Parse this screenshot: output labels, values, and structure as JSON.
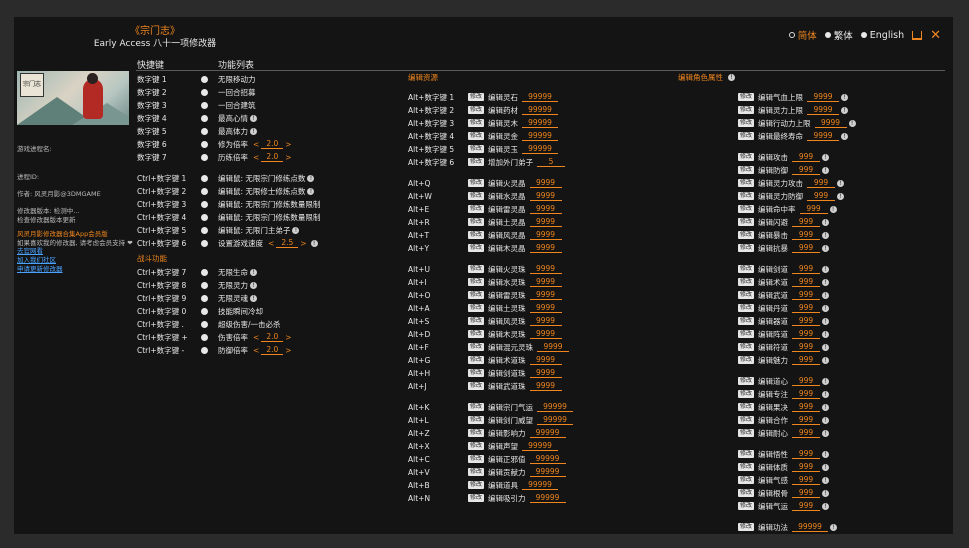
{
  "header": {
    "game_title": "《宗门志》",
    "app_title": "Early Access 八十一项修改器"
  },
  "languages": [
    {
      "label": "简体",
      "active": true
    },
    {
      "label": "繁体",
      "active": false
    },
    {
      "label": "English",
      "active": false
    }
  ],
  "columns": {
    "hotkey": "快捷键",
    "features": "功能列表"
  },
  "left_panel": {
    "process_label": "游戏进程名:",
    "pid_label": "进程ID:",
    "author": "作者: 风灵月影@3DMGAME",
    "version_line1": "修改器版本: 检测中...",
    "version_line2": "检查修改器版本更新",
    "promo": "风灵月影修改器合集App会员版",
    "promo_sub": "如果喜欢我的修改器, 请考虑会员支持 ❤",
    "link1": "去官网看",
    "link2": "加入我们社区",
    "link3": "申请更新修改器"
  },
  "col1": [
    {
      "hotkey": "数字键 1",
      "label": "无限移动力"
    },
    {
      "hotkey": "数字键 2",
      "label": "一回合招募"
    },
    {
      "hotkey": "数字键 3",
      "label": "一回合建筑"
    },
    {
      "hotkey": "数字键 4",
      "label": "最高心情",
      "tip": true
    },
    {
      "hotkey": "数字键 5",
      "label": "最高体力",
      "tip": true
    },
    {
      "hotkey": "数字键 6",
      "label": "修为倍率",
      "spin": "2.0"
    },
    {
      "hotkey": "数字键 7",
      "label": "历练倍率",
      "spin": "2.0"
    },
    {
      "gap": true
    },
    {
      "hotkey": "Ctrl+数字键 1",
      "label": "编辑鼠: 无限宗门修练点数",
      "tip": true
    },
    {
      "hotkey": "Ctrl+数字键 2",
      "label": "编辑鼠: 无限修士修炼点数",
      "tip": true
    },
    {
      "hotkey": "Ctrl+数字键 3",
      "label": "编辑鼠: 无限宗门修炼数量限制"
    },
    {
      "hotkey": "Ctrl+数字键 4",
      "label": "编辑鼠: 无限宗门修炼数量限制"
    },
    {
      "hotkey": "Ctrl+数字键 5",
      "label": "编辑鼠: 无限门主弟子",
      "tip": true
    },
    {
      "hotkey": "Ctrl+数字键 6",
      "label": "设置游戏速度",
      "spin": "2.5",
      "tip": true
    },
    {
      "section": "战斗功能"
    },
    {
      "hotkey": "Ctrl+数字键 7",
      "label": "无限生命",
      "tip": true
    },
    {
      "hotkey": "Ctrl+数字键 8",
      "label": "无限灵力",
      "tip": true
    },
    {
      "hotkey": "Ctrl+数字键 9",
      "label": "无限灵魂",
      "tip": true
    },
    {
      "hotkey": "Ctrl+数字键 0",
      "label": "技能瞬间冷却"
    },
    {
      "hotkey": "Ctrl+数字键 .",
      "label": "超级伤害/一击必杀"
    },
    {
      "hotkey": "Ctrl+数字键 +",
      "label": "伤害倍率",
      "spin": "2.0"
    },
    {
      "hotkey": "Ctrl+数字键 -",
      "label": "防御倍率",
      "spin": "2.0"
    }
  ],
  "col2_title": "编辑资源",
  "col2": [
    {
      "hotkey": "Alt+数字键 1",
      "label": "编辑灵石",
      "value": "99999"
    },
    {
      "hotkey": "Alt+数字键 2",
      "label": "编辑药材",
      "value": "99999"
    },
    {
      "hotkey": "Alt+数字键 3",
      "label": "编辑灵木",
      "value": "99999"
    },
    {
      "hotkey": "Alt+数字键 4",
      "label": "编辑灵金",
      "value": "99999"
    },
    {
      "hotkey": "Alt+数字键 5",
      "label": "编辑灵玉",
      "value": "99999"
    },
    {
      "hotkey": "Alt+数字键 6",
      "label": "增加外门弟子",
      "value": "5"
    },
    {
      "gap": true
    },
    {
      "hotkey": "Alt+Q",
      "label": "编辑火灵晶",
      "value": "9999"
    },
    {
      "hotkey": "Alt+W",
      "label": "编辑水灵晶",
      "value": "9999"
    },
    {
      "hotkey": "Alt+E",
      "label": "编辑雷灵晶",
      "value": "9999"
    },
    {
      "hotkey": "Alt+R",
      "label": "编辑土灵晶",
      "value": "9999"
    },
    {
      "hotkey": "Alt+T",
      "label": "编辑风灵晶",
      "value": "9999"
    },
    {
      "hotkey": "Alt+Y",
      "label": "编辑木灵晶",
      "value": "9999"
    },
    {
      "gap": true
    },
    {
      "hotkey": "Alt+U",
      "label": "编辑火灵珠",
      "value": "9999"
    },
    {
      "hotkey": "Alt+I",
      "label": "编辑水灵珠",
      "value": "9999"
    },
    {
      "hotkey": "Alt+O",
      "label": "编辑雷灵珠",
      "value": "9999"
    },
    {
      "hotkey": "Alt+A",
      "label": "编辑土灵珠",
      "value": "9999"
    },
    {
      "hotkey": "Alt+S",
      "label": "编辑风灵珠",
      "value": "9999"
    },
    {
      "hotkey": "Alt+D",
      "label": "编辑木灵珠",
      "value": "9999"
    },
    {
      "hotkey": "Alt+F",
      "label": "编辑混元灵珠",
      "value": "9999"
    },
    {
      "hotkey": "Alt+G",
      "label": "编辑术道珠",
      "value": "9999"
    },
    {
      "hotkey": "Alt+H",
      "label": "编辑剑道珠",
      "value": "9999"
    },
    {
      "hotkey": "Alt+J",
      "label": "编辑武道珠",
      "value": "9999"
    },
    {
      "gap": true
    },
    {
      "hotkey": "Alt+K",
      "label": "编辑宗门气运",
      "value": "99999"
    },
    {
      "hotkey": "Alt+L",
      "label": "编辑剑门威望",
      "value": "99999"
    },
    {
      "hotkey": "Alt+Z",
      "label": "编辑影响力",
      "value": "99999"
    },
    {
      "hotkey": "Alt+X",
      "label": "编辑声望",
      "value": "99999"
    },
    {
      "hotkey": "Alt+C",
      "label": "编辑正邪值",
      "value": "99999"
    },
    {
      "hotkey": "Alt+V",
      "label": "编辑贡献力",
      "value": "99999"
    },
    {
      "hotkey": "Alt+B",
      "label": "编辑道具",
      "value": "99999"
    },
    {
      "hotkey": "Alt+N",
      "label": "编辑吸引力",
      "value": "99999"
    }
  ],
  "col3_title": "编辑角色属性",
  "col3": [
    {
      "label": "编辑气血上限",
      "value": "9999",
      "tip": true
    },
    {
      "label": "编辑灵力上限",
      "value": "9999",
      "tip": true
    },
    {
      "label": "编辑行动力上限",
      "value": "9999",
      "tip": true
    },
    {
      "label": "编辑最终寿命",
      "value": "9999",
      "tip": true
    },
    {
      "gap": true
    },
    {
      "label": "编辑攻击",
      "value": "999",
      "tip": true
    },
    {
      "label": "编辑防御",
      "value": "999",
      "tip": true
    },
    {
      "label": "编辑灵力攻击",
      "value": "999",
      "tip": true
    },
    {
      "label": "编辑灵力防御",
      "value": "999",
      "tip": true
    },
    {
      "label": "编辑命中率",
      "value": "999",
      "tip": true
    },
    {
      "label": "编辑闪避",
      "value": "999",
      "tip": true
    },
    {
      "label": "编辑暴击",
      "value": "999",
      "tip": true
    },
    {
      "label": "编辑抗暴",
      "value": "999",
      "tip": true
    },
    {
      "gap": true
    },
    {
      "label": "编辑剑道",
      "value": "999",
      "tip": true
    },
    {
      "label": "编辑术道",
      "value": "999",
      "tip": true
    },
    {
      "label": "编辑武道",
      "value": "999",
      "tip": true
    },
    {
      "label": "编辑丹道",
      "value": "999",
      "tip": true
    },
    {
      "label": "编辑器道",
      "value": "999",
      "tip": true
    },
    {
      "label": "编辑阵道",
      "value": "999",
      "tip": true
    },
    {
      "label": "编辑符道",
      "value": "999",
      "tip": true
    },
    {
      "label": "编辑魅力",
      "value": "999",
      "tip": true
    },
    {
      "gap": true
    },
    {
      "label": "编辑道心",
      "value": "999",
      "tip": true
    },
    {
      "label": "编辑专注",
      "value": "999",
      "tip": true
    },
    {
      "label": "编辑果决",
      "value": "999",
      "tip": true
    },
    {
      "label": "编辑合作",
      "value": "999",
      "tip": true
    },
    {
      "label": "编辑耐心",
      "value": "999",
      "tip": true
    },
    {
      "gap": true
    },
    {
      "label": "编辑悟性",
      "value": "999",
      "tip": true
    },
    {
      "label": "编辑体质",
      "value": "999",
      "tip": true
    },
    {
      "label": "编辑气感",
      "value": "999",
      "tip": true
    },
    {
      "label": "编辑根骨",
      "value": "999",
      "tip": true
    },
    {
      "label": "编辑气运",
      "value": "999",
      "tip": true
    },
    {
      "gap": true
    },
    {
      "label": "编辑功法",
      "value": "99999",
      "tip": true
    }
  ],
  "ui": {
    "button": "修改",
    "arrow_left": "<",
    "arrow_right": ">",
    "tip_glyph": "!"
  },
  "colors": {
    "accent": "#f0861e",
    "background": "#141414",
    "text": "#e8e8e8"
  }
}
